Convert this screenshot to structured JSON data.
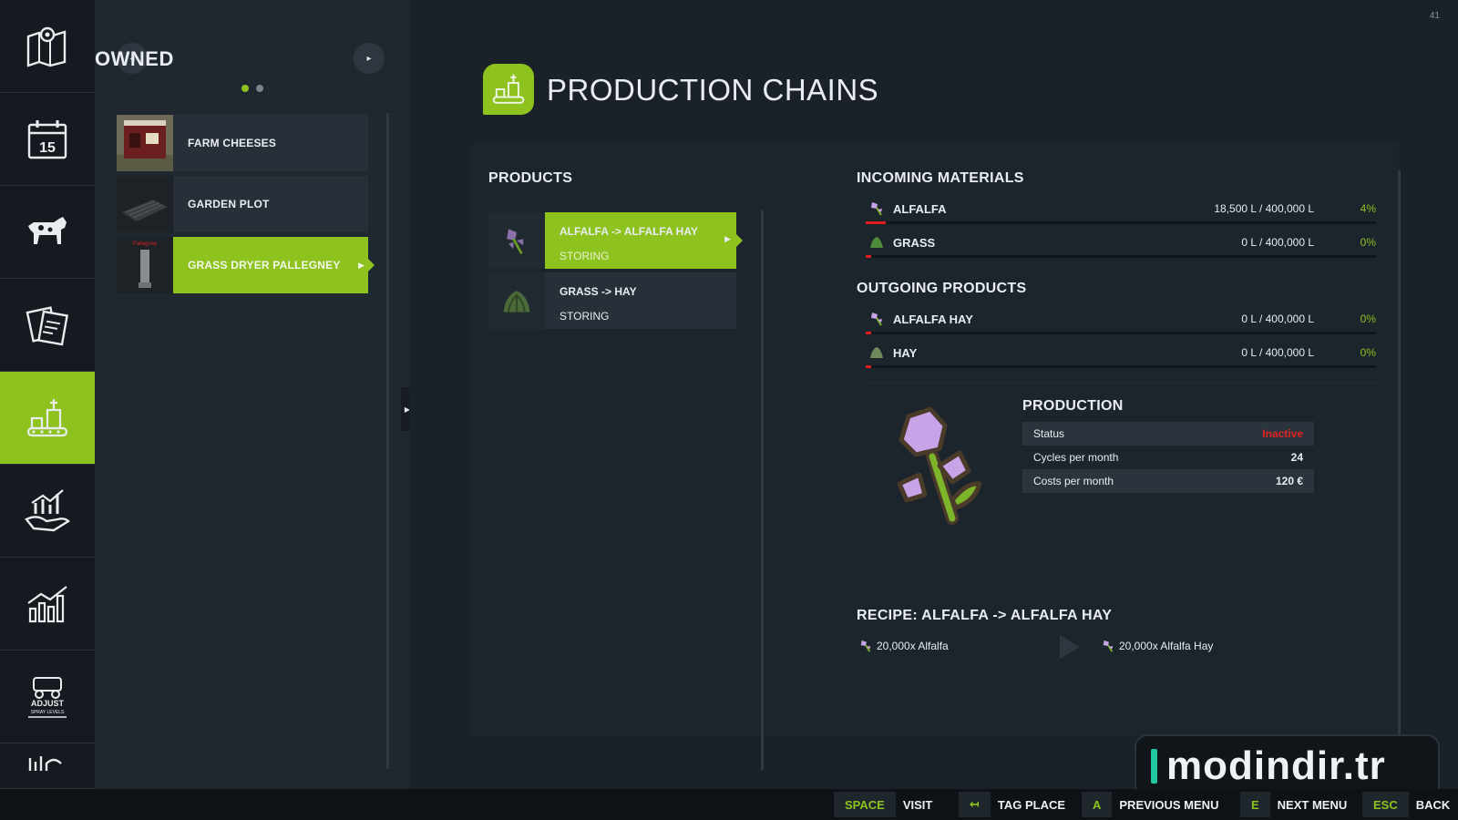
{
  "owned": {
    "title": "OWNED",
    "prev_glyph": "◂",
    "next_glyph": "▸",
    "items": [
      {
        "label": "FARM CHEESES"
      },
      {
        "label": "GARDEN PLOT"
      },
      {
        "label": "GRASS DRYER PALLEGNEY"
      }
    ],
    "active_index": 2,
    "thumb_stamp": "Pallegney"
  },
  "nav": {
    "icons": [
      "map-icon",
      "calendar-icon",
      "cow-icon",
      "contracts-icon",
      "production-icon",
      "finances-icon",
      "statistics-icon",
      "spray-levels-icon",
      "more-icon"
    ],
    "calendar_day": "15",
    "spray_text": "ADJUST",
    "spray_sub": "SPRAY LEVELS"
  },
  "header": {
    "title": "PRODUCTION CHAINS",
    "corner_number": "41"
  },
  "products": {
    "heading": "PRODUCTS",
    "items": [
      {
        "name": "ALFALFA -> ALFALFA HAY",
        "status": "STORING"
      },
      {
        "name": "GRASS -> HAY",
        "status": "STORING"
      }
    ]
  },
  "incoming": {
    "heading": "INCOMING MATERIALS",
    "items": [
      {
        "name": "ALFALFA",
        "amount": "18,500 L / 400,000 L",
        "percent": "4%",
        "fill": 0.04
      },
      {
        "name": "GRASS",
        "amount": "0 L / 400,000 L",
        "percent": "0%",
        "fill": 0
      }
    ]
  },
  "outgoing": {
    "heading": "OUTGOING PRODUCTS",
    "items": [
      {
        "name": "ALFALFA HAY",
        "amount": "0 L / 400,000 L",
        "percent": "0%",
        "fill": 0
      },
      {
        "name": "HAY",
        "amount": "0 L / 400,000 L",
        "percent": "0%",
        "fill": 0
      }
    ]
  },
  "production": {
    "heading": "PRODUCTION",
    "rows": [
      {
        "label": "Status",
        "value": "Inactive"
      },
      {
        "label": "Cycles per month",
        "value": "24"
      },
      {
        "label": "Costs per month",
        "value": "120 €"
      }
    ]
  },
  "recipe": {
    "heading": "RECIPE: ALFALFA -> ALFALFA HAY",
    "input": "20,000x Alfalfa",
    "output": "20,000x Alfalfa Hay"
  },
  "watermark": {
    "text": "modindir.tr"
  },
  "footer": {
    "hints": [
      {
        "key": "SPACE",
        "label": "VISIT"
      },
      {
        "key": "↤",
        "label": "TAG PLACE"
      },
      {
        "key": "A",
        "label": "PREVIOUS MENU"
      },
      {
        "key": "E",
        "label": "NEXT MENU"
      },
      {
        "key": "ESC",
        "label": "BACK"
      }
    ]
  },
  "colors": {
    "accent": "#8dc21f",
    "warning": "#e12323",
    "alfalfa_flower": "#c9a3e8",
    "leaf": "#7cb52a"
  }
}
